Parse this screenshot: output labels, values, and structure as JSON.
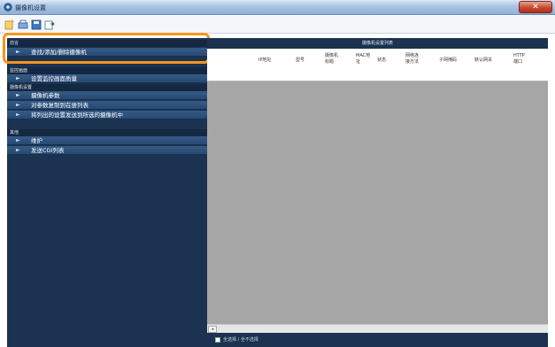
{
  "window": {
    "title": "摄像机设置",
    "close_label": "✕"
  },
  "toolbar": {
    "buttons": [
      "new-icon",
      "connect-icon",
      "save-icon",
      "export-icon"
    ]
  },
  "sidebar": {
    "groups": [
      {
        "header": "前言",
        "items": [
          {
            "label": "查找/添加/删除摄像机"
          }
        ]
      },
      {
        "header": "监控画面",
        "items": [
          {
            "label": "设置监控画面质量"
          }
        ]
      },
      {
        "header": "摄像机设置",
        "items": [
          {
            "label": "摄像机参数"
          },
          {
            "label": "对参数复制到在册列表"
          },
          {
            "label": "将列出的设置发送到所选的摄像机中"
          }
        ]
      },
      {
        "header": "其他",
        "items": [
          {
            "label": "维护"
          },
          {
            "label": "发送CGI列表"
          }
        ]
      }
    ]
  },
  "main": {
    "panel_title": "摄像机设置列表",
    "columns": [
      "IP地址",
      "型号",
      "摄像机\n标题",
      "MAC地\n址",
      "状态",
      "网络连\n接方法",
      "子网掩码",
      "默认网关",
      "HTTP\n端口"
    ],
    "scroll_left_label": "◂",
    "footer": {
      "select_all_label": "全选择 / 全不选择"
    }
  },
  "colors": {
    "panel_dark": "#1b3250",
    "menu_item": "#2f5480",
    "highlight": "#f7951d",
    "grid_area": "#a6a6a6"
  }
}
